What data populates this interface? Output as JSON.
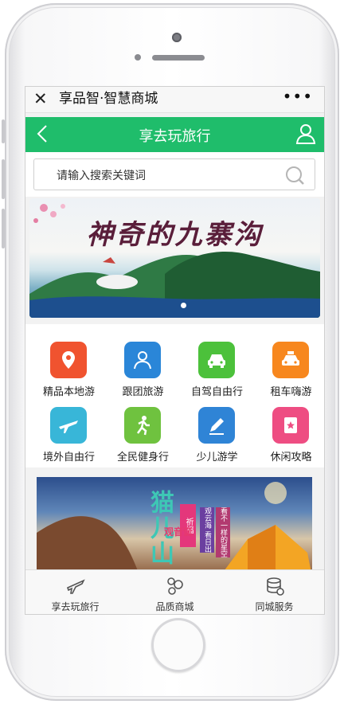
{
  "topbar": {
    "close": "✕",
    "title": "享品智·智慧商城",
    "more": "•••"
  },
  "header": {
    "title": "享去玩旅行",
    "bg_color": "#1fbd6b"
  },
  "search": {
    "placeholder": "请输入搜索关键词"
  },
  "banner": {
    "title": "神奇的九寨沟",
    "slide_count_visible": 1
  },
  "grid": [
    {
      "label": "精品本地游",
      "icon": "location-pin-icon",
      "color": "#f0532f"
    },
    {
      "label": "跟团旅游",
      "icon": "group-people-icon",
      "color": "#2a86d8"
    },
    {
      "label": "自驾自由行",
      "icon": "car-icon",
      "color": "#4cc13b"
    },
    {
      "label": "租车嗨游",
      "icon": "taxi-icon",
      "color": "#f7871e"
    },
    {
      "label": "境外自由行",
      "icon": "airplane-icon",
      "color": "#38b6d8"
    },
    {
      "label": "全民健身行",
      "icon": "running-icon",
      "color": "#6fc23f"
    },
    {
      "label": "少儿游学",
      "icon": "pencil-icon",
      "color": "#2f84d6"
    },
    {
      "label": "休闲攻略",
      "icon": "bookmark-star-icon",
      "color": "#ee4d82"
    }
  ],
  "promo": {
    "title": "猫儿山",
    "tag": "祈福",
    "line1": "观云海 看日出",
    "line2": "看不一样的星空",
    "line3": "观音诞"
  },
  "tabbar": [
    {
      "label": "享去玩旅行",
      "icon": "airplane-icon"
    },
    {
      "label": "品质商城",
      "icon": "shop-bubbles-icon"
    },
    {
      "label": "同城服务",
      "icon": "coins-stack-icon"
    }
  ]
}
